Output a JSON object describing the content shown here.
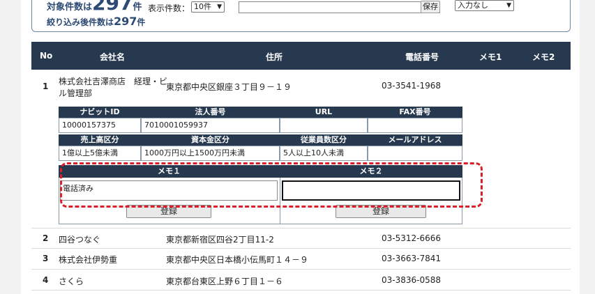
{
  "summary": {
    "total_label": "対象件数は",
    "total_count": "297",
    "total_suffix": "件",
    "filtered_label": "絞り込み後件数は",
    "filtered_count": "297",
    "filtered_suffix": "件"
  },
  "controls": {
    "display_count_label": "表示件数：",
    "display_count_value": "10件",
    "save_label": "保存",
    "input_filter_value": "入力なし"
  },
  "table": {
    "headers": [
      "No",
      "会社名",
      "住所",
      "電話番号",
      "メモ1",
      "メモ2"
    ],
    "rows": [
      {
        "no": "1",
        "company": "株式会社吉澤商店　経理・ビル管理部",
        "company_l1": "株式会社吉澤商店　経理・ビ",
        "company_l2": "ル管理部",
        "address": "東京都中央区銀座３丁目９－１９",
        "phone": "03-3541-1968"
      },
      {
        "no": "2",
        "company": "四谷つなぐ",
        "address": "東京都新宿区四谷2丁目11-2",
        "phone": "03-5312-6666"
      },
      {
        "no": "3",
        "company": "株式会社伊勢重",
        "address": "東京都中央区日本橋小伝馬町１４－９",
        "phone": "03-3663-7841"
      },
      {
        "no": "4",
        "company": "さくら",
        "address": "東京都台東区上野６丁目１－６",
        "phone": "03-3836-0588"
      }
    ]
  },
  "detail": {
    "headers1": [
      "ナビットID",
      "法人番号",
      "URL",
      "FAX番号"
    ],
    "values1": [
      "10000157375",
      "7010001059937",
      "",
      ""
    ],
    "headers2": [
      "売上高区分",
      "資本金区分",
      "従業員数区分",
      "メールアドレス"
    ],
    "values2": [
      "1億以上5億未満",
      "1000万円以上1500万円未満",
      "5人以上10人未満",
      ""
    ],
    "memo1_header": "メモ１",
    "memo2_header": "メモ２",
    "memo1_value": "電話済み",
    "memo2_value": "",
    "register_label": "登録"
  },
  "colors": {
    "header_bg": "#26394f",
    "highlight_dash": "#d9202a",
    "summary_text": "#2c4a73"
  }
}
